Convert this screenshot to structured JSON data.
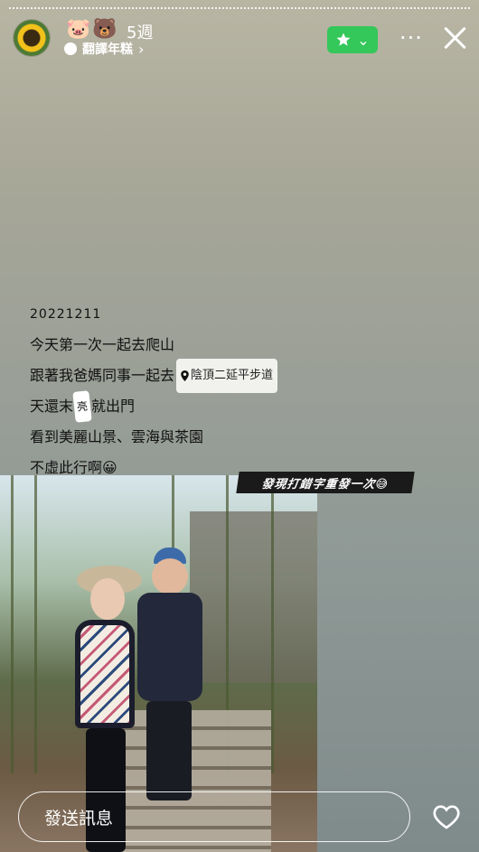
{
  "header": {
    "emojis": "🐷🐻",
    "time": "5週",
    "translate_label": "翻譯年糕",
    "chevron": "›",
    "fav_chevron": "⌄",
    "more": "···"
  },
  "caption": {
    "date": "20221211",
    "line1": "今天第一次一起去爬山",
    "line2": "跟著我爸媽同事一起去",
    "location": "陰頂二延平步道",
    "line3_a": "天還末",
    "line3_sticker": "亮",
    "line3_b": "就出門",
    "line4": "看到美麗山景、雲海與茶園",
    "line5": "不虛此行啊😀"
  },
  "banner": {
    "text": "發現打錯字重發一次😅"
  },
  "reply": {
    "placeholder": "發送訊息"
  },
  "colors": {
    "accent_green": "#34c759"
  }
}
